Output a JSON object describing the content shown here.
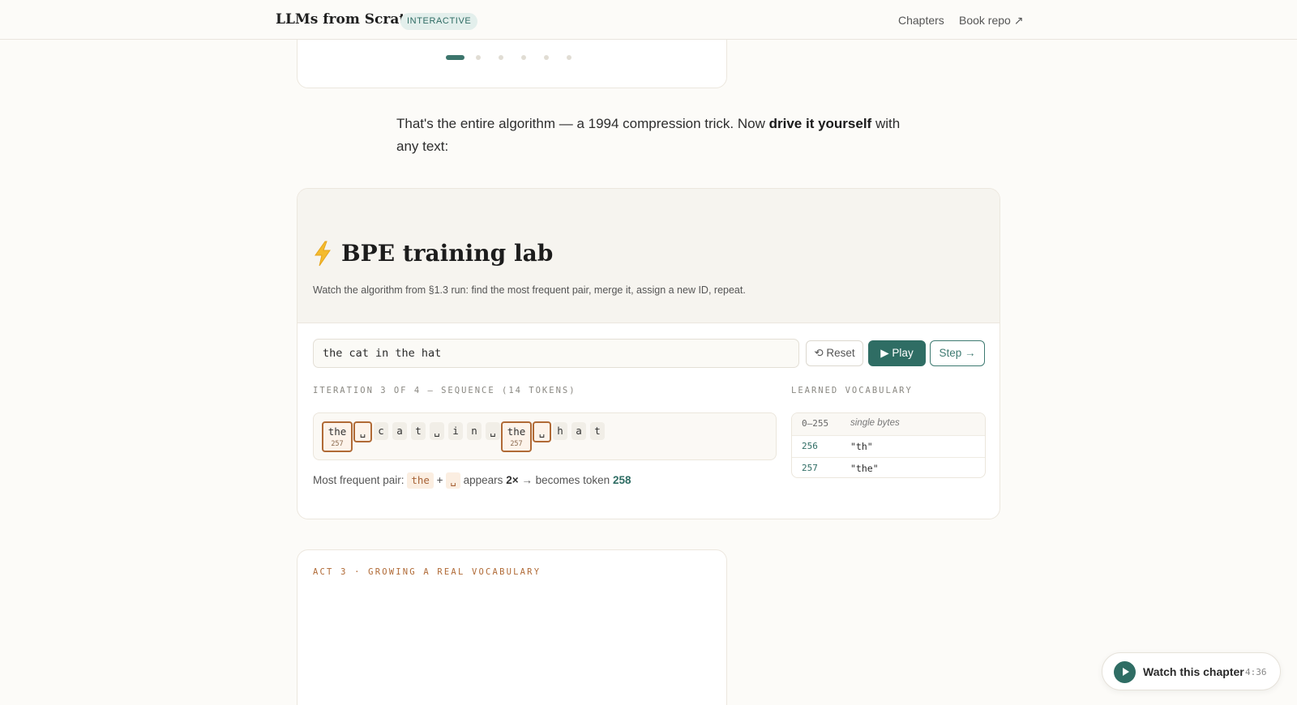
{
  "header": {
    "brand": "LLMs from Scratch",
    "badge": "INTERACTIVE",
    "nav": {
      "chapters": "Chapters",
      "repo": "Book repo ↗"
    }
  },
  "carousel": {
    "dot_count": 6,
    "active_index": 0
  },
  "intro": {
    "before": "That's the entire algorithm — a 1994 compression trick. Now ",
    "bold": "drive it yourself",
    "after": " with any text:"
  },
  "lab": {
    "title": "BPE training lab",
    "subtitle": "Watch the algorithm from §1.3 run: find the most frequent pair, merge it, assign a new ID, repeat.",
    "input_value": "the cat in the hat",
    "buttons": {
      "reset": "⟲ Reset",
      "play": "▶ Play",
      "step": "Step →"
    },
    "sequence_label": "ITERATION 3 OF 4 — SEQUENCE (14 TOKENS)",
    "vocab_label": "LEARNED VOCABULARY",
    "tokens": [
      {
        "text": "the",
        "id": "257",
        "highlight": true
      },
      {
        "text": "␣",
        "id": "",
        "highlight": true
      },
      {
        "text": "c",
        "id": "",
        "highlight": false
      },
      {
        "text": "a",
        "id": "",
        "highlight": false
      },
      {
        "text": "t",
        "id": "",
        "highlight": false
      },
      {
        "text": "␣",
        "id": "",
        "highlight": false
      },
      {
        "text": "i",
        "id": "",
        "highlight": false
      },
      {
        "text": "n",
        "id": "",
        "highlight": false
      },
      {
        "text": "␣",
        "id": "",
        "highlight": false
      },
      {
        "text": "the",
        "id": "257",
        "highlight": true
      },
      {
        "text": "␣",
        "id": "",
        "highlight": true
      },
      {
        "text": "h",
        "id": "",
        "highlight": false
      },
      {
        "text": "a",
        "id": "",
        "highlight": false
      },
      {
        "text": "t",
        "id": "",
        "highlight": false
      }
    ],
    "frequent": {
      "prefix": "Most frequent pair:",
      "left": "the",
      "plus": "+",
      "right": "␣",
      "appears": "appears",
      "count": "2×",
      "arrow_text": "→ becomes token",
      "new_id": "258"
    },
    "vocabulary": [
      {
        "id": "0–255",
        "value": "single bytes"
      },
      {
        "id": "256",
        "value": "\"th\""
      },
      {
        "id": "257",
        "value": "\"the\""
      }
    ]
  },
  "act3": {
    "label": "ACT 3 · GROWING A REAL VOCABULARY"
  },
  "watch": {
    "label": "Watch this chapter",
    "duration": "4:36"
  },
  "colors": {
    "accent": "#2f6d64",
    "highlight": "#b06a36",
    "background": "#fcfbf8"
  }
}
